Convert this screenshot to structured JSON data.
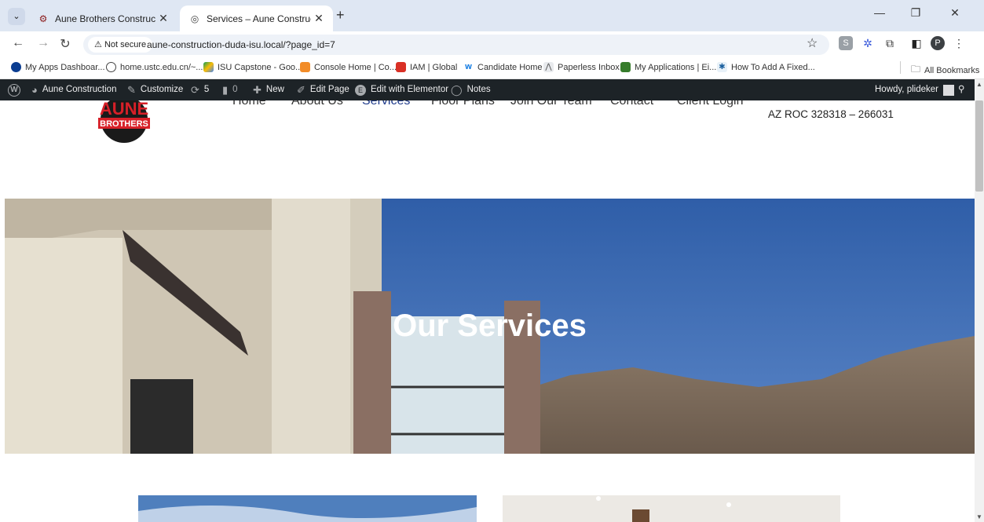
{
  "browser": {
    "tabs": [
      {
        "title": "Aune Brothers Construction",
        "close": "✕"
      },
      {
        "title": "Services – Aune Construction",
        "close": "✕"
      }
    ],
    "new_tab": "+",
    "security_label": "Not secure",
    "url": "aune-construction-duda-isu.local/?page_id=7",
    "profile_initial": "P",
    "bookmarks": [
      "My Apps Dashboar...",
      "home.ustc.edu.cn/~...",
      "ISU Capstone - Goo...",
      "Console Home | Co...",
      "IAM | Global",
      "Candidate Home",
      "Paperless Inbox",
      "My Applications | Ei...",
      "How To Add A Fixed..."
    ],
    "all_bookmarks": "All Bookmarks"
  },
  "admin_bar": {
    "site_name": "Aune Construction",
    "customize": "Customize",
    "updates_count": "5",
    "comments_count": "0",
    "new": "New",
    "edit_page": "Edit Page",
    "edit_elementor": "Edit with Elementor",
    "notes": "Notes",
    "howdy": "Howdy, plideker"
  },
  "site": {
    "logo_text": "AUNE BROTHERS",
    "nav": [
      "Home",
      "About Us",
      "Services",
      "Floor Plans",
      "Join Our Team",
      "Contact",
      "Client Login"
    ],
    "roc": "AZ ROC 328318 – 266031",
    "hero_title": "Our Services"
  }
}
